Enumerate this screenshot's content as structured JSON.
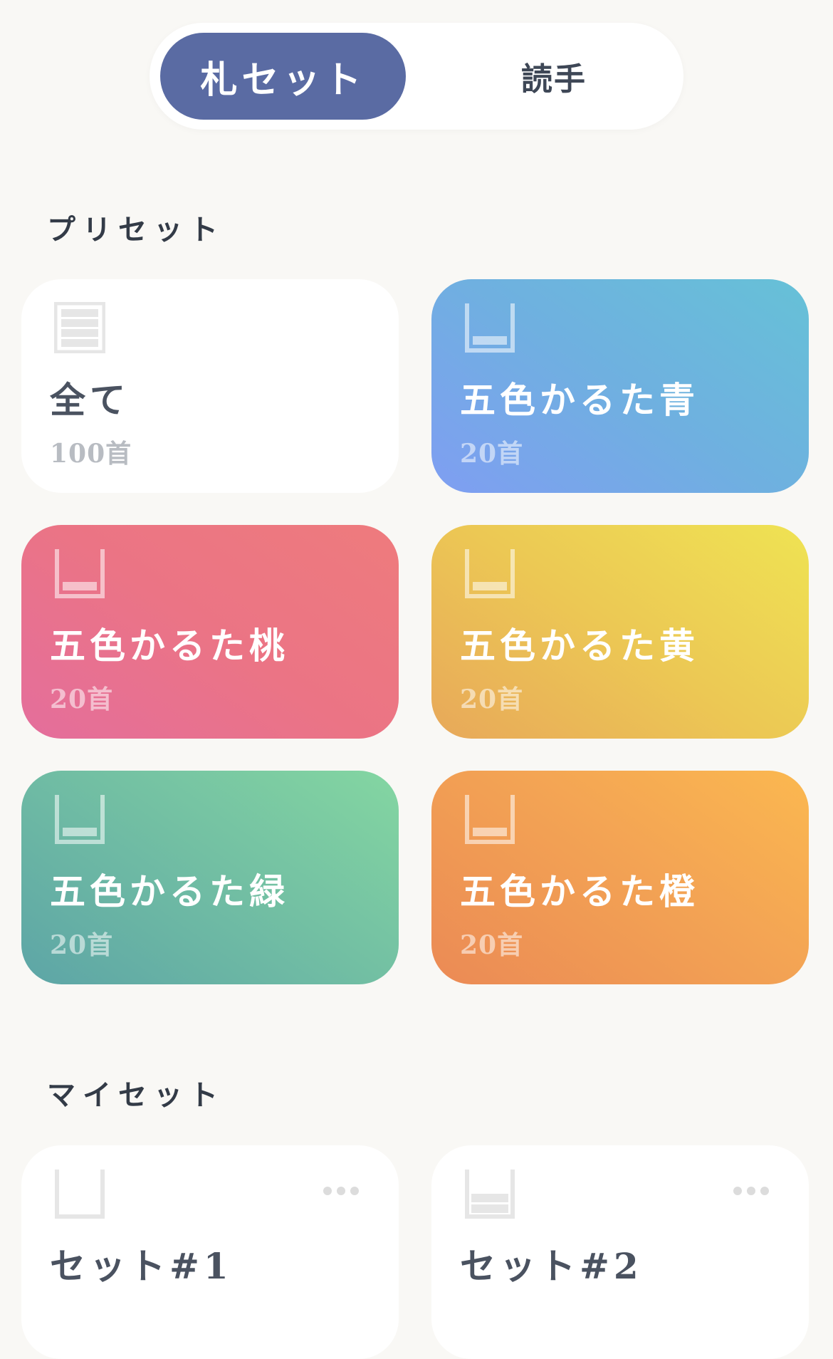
{
  "segmented": {
    "active_label": "札セット",
    "inactive_label": "読手"
  },
  "presets": {
    "title": "プリセット",
    "cards": [
      {
        "name": "全て",
        "count": "100首",
        "icon": "stack-full-icon"
      },
      {
        "name": "五色かるた青",
        "count": "20首",
        "icon": "tray-icon",
        "color": "#6fb0e0"
      },
      {
        "name": "五色かるた桃",
        "count": "20首",
        "icon": "tray-icon",
        "color": "#eb7485"
      },
      {
        "name": "五色かるた黄",
        "count": "20首",
        "icon": "tray-icon",
        "color": "#ecc854"
      },
      {
        "name": "五色かるた緑",
        "count": "20首",
        "icon": "tray-icon",
        "color": "#73c0a3"
      },
      {
        "name": "五色かるた橙",
        "count": "20首",
        "icon": "tray-icon",
        "color": "#f3a354"
      }
    ]
  },
  "my_sets": {
    "title": "マイセット",
    "cards": [
      {
        "name": "セット#1",
        "icon": "tray-empty-icon"
      },
      {
        "name": "セット#2",
        "icon": "tray-partial-icon"
      }
    ]
  }
}
